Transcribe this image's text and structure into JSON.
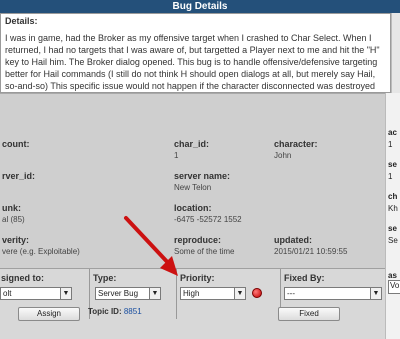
{
  "window": {
    "title": "Bug Details"
  },
  "details": {
    "label": "Details:",
    "text": "I was in game, had the Broker as my offensive target when I crashed to Char Select. When I returned, I had no targets that I was aware of, but targetted a Player next to me and hit the \"H\" key to Hail him. The Broker dialog opened. This bug is to handle offensive/defensive targeting better for Hail commands (I still do not think H should open dialogs at all, but merely say Hail, so-and-so) This specific issue would not happen if the character disconnected was destroyed entirely, just a chance I happened to catch it."
  },
  "fields": {
    "account": {
      "label": "count:",
      "value": ""
    },
    "char_id": {
      "label": "char_id:",
      "value": "1"
    },
    "character": {
      "label": "character:",
      "value": "John"
    },
    "server_id": {
      "label": "rver_id:",
      "value": ""
    },
    "server_name": {
      "label": "server name:",
      "value": "New Telon"
    },
    "zone": {
      "label": "unk:",
      "value": "al (85)"
    },
    "location": {
      "label": "location:",
      "value": "-6475 -52572 1552"
    },
    "severity": {
      "label": "verity:",
      "value": "vere (e.g. Exploitable)"
    },
    "reproduce": {
      "label": "reproduce:",
      "value": "Some of the time"
    },
    "updated": {
      "label": "updated:",
      "value": "2015/01/21 10:59:55"
    }
  },
  "right_column": {
    "items": [
      "ac",
      "1",
      "se",
      "1",
      "ch",
      "Kh",
      "se",
      "Se"
    ]
  },
  "bottom": {
    "assigned_to": {
      "label": "signed to:",
      "value": "olt"
    },
    "type": {
      "label": "Type:",
      "value": "Server Bug"
    },
    "priority": {
      "label": "Priority:",
      "value": "High"
    },
    "fixed_by": {
      "label": "Fixed By:",
      "value": "---"
    },
    "assign_button": "Assign",
    "topic_label": "Topic ID:",
    "topic_id": "8851",
    "fixed_button": "Fixed",
    "right_label": "as",
    "right_value": "Vo"
  },
  "colors": {
    "titlebar": "#24507a",
    "info_bg": "#cfcfcf",
    "annotation_arrow": "#cc1111",
    "status_dot": "#c40000"
  }
}
